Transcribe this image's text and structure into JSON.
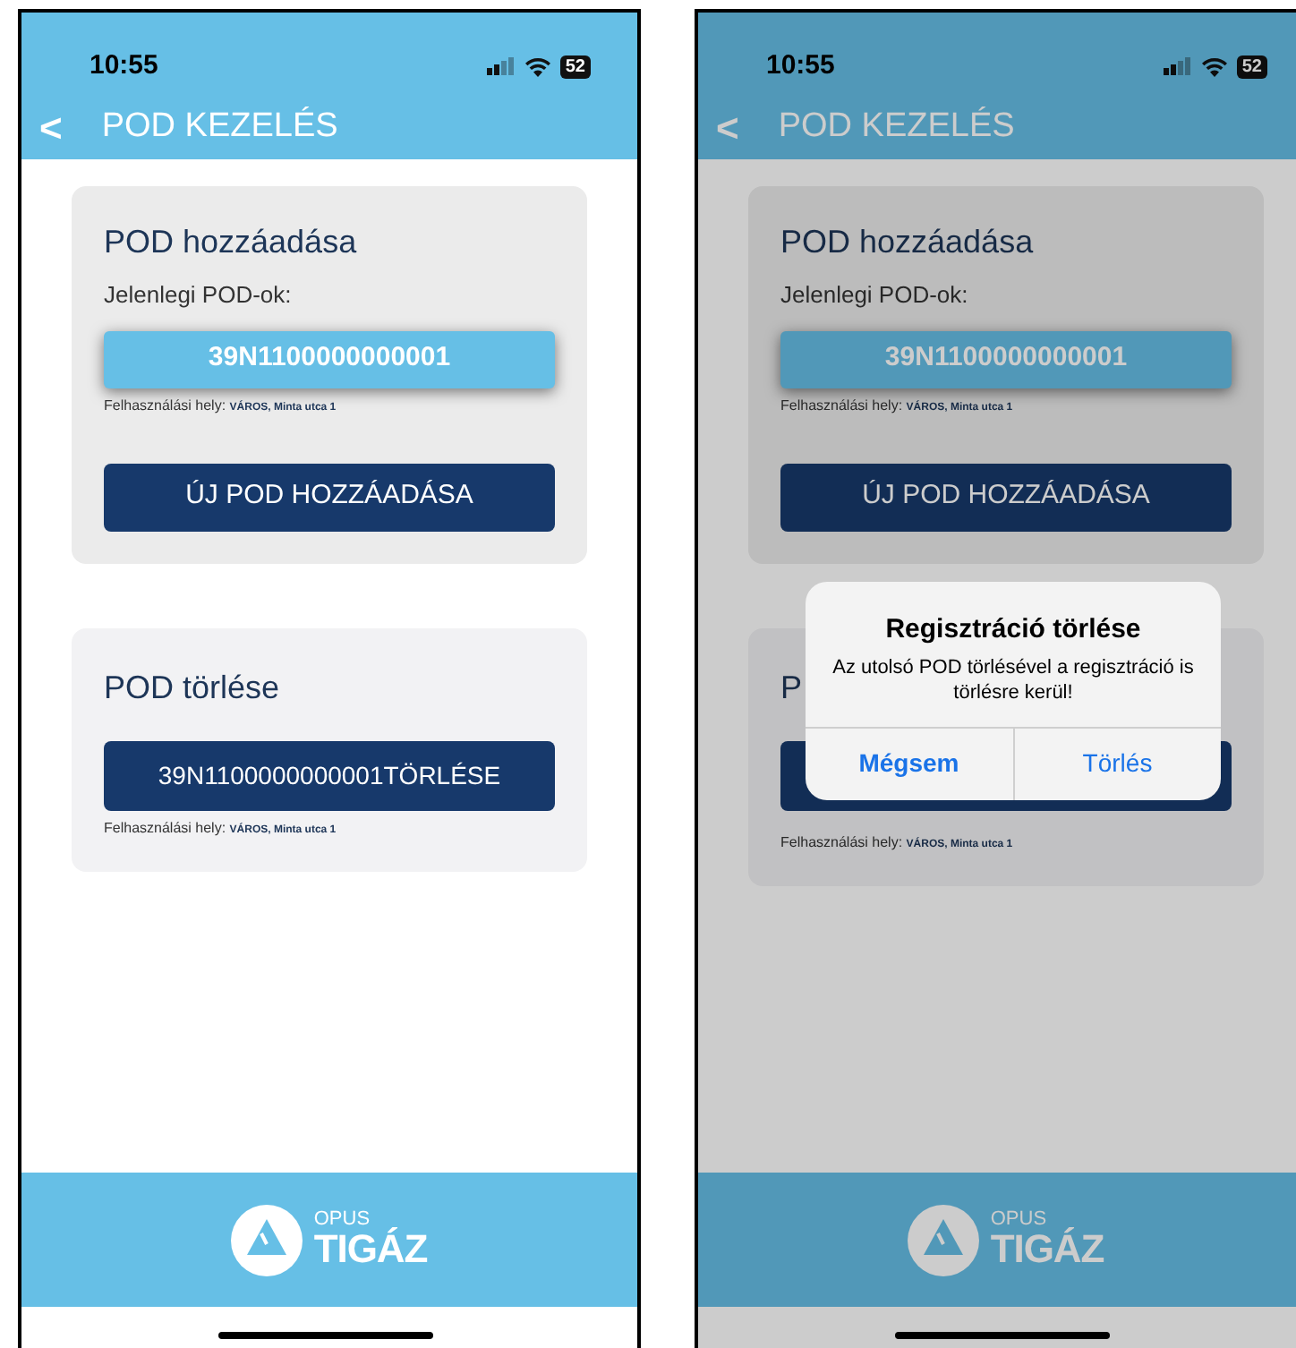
{
  "screens": [
    {
      "status_bar": {
        "time": "10:55",
        "battery": "52"
      },
      "header": {
        "back": "<",
        "title": "POD KEZELÉS"
      },
      "add_card": {
        "title": "POD hozzáadása",
        "label": "Jelenlegi POD-ok:",
        "pods": [
          {
            "id": "39N1100000000001",
            "place_label": "Felhasználási hely:",
            "place": "VÁROS, Minta utca 1"
          }
        ],
        "button": "ÚJ POD HOZZÁADÁSA"
      },
      "delete_card": {
        "title": "POD törlése",
        "button": "39N1100000000001TÖRLÉSE",
        "place_label": "Felhasználási hely:",
        "place": "VÁROS, Minta utca 1"
      },
      "footer": {
        "logo_small": "OPUS",
        "logo_big": "TIGÁZ"
      },
      "dimmed": false
    },
    {
      "status_bar": {
        "time": "10:55",
        "battery": "52"
      },
      "header": {
        "back": "<",
        "title": "POD KEZELÉS"
      },
      "add_card": {
        "title": "POD hozzáadása",
        "label": "Jelenlegi POD-ok:",
        "pods": [
          {
            "id": "39N1100000000001",
            "place_label": "Felhasználási hely:",
            "place": "VÁROS, Minta utca 1"
          }
        ],
        "button": "ÚJ POD HOZZÁADÁSA"
      },
      "delete_card": {
        "title": "P",
        "place_label": "Felhasználási hely:",
        "place": "VÁROS, Minta utca 1"
      },
      "footer": {
        "logo_small": "OPUS",
        "logo_big": "TIGÁZ"
      },
      "dimmed": true,
      "dialog": {
        "title": "Regisztráció törlése",
        "message": "Az utolsó POD törlésével a regisztráció is törlésre kerül!",
        "buttons": [
          {
            "label": "Mégsem",
            "bold": true
          },
          {
            "label": "Törlés",
            "bold": false
          }
        ]
      }
    }
  ]
}
